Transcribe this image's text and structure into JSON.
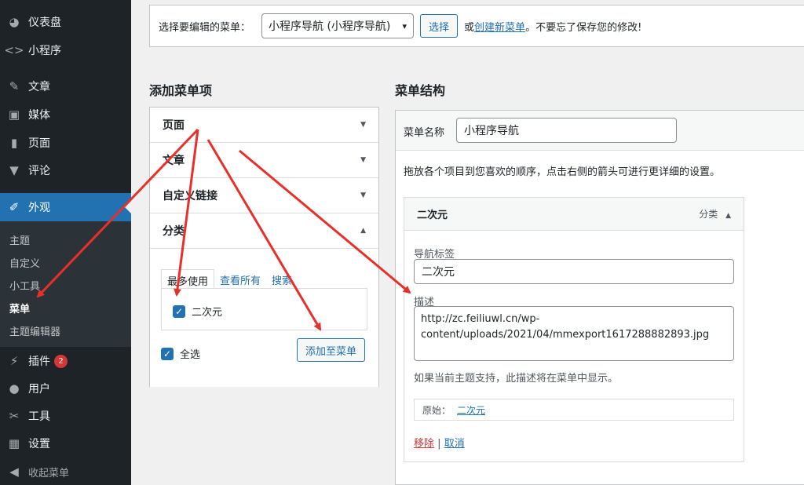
{
  "sidebar": {
    "dashboard": "仪表盘",
    "miniprogram": "小程序",
    "posts": "文章",
    "media": "媒体",
    "pages": "页面",
    "comments": "评论",
    "appearance": "外观",
    "submenu": [
      "主题",
      "自定义",
      "小工具",
      "菜单",
      "主题编辑器"
    ],
    "plugins": "插件",
    "plugins_badge": "2",
    "users": "用户",
    "tools": "工具",
    "settings": "设置",
    "collapse": "收起菜单"
  },
  "manage": {
    "label": "选择要编辑的菜单：",
    "selected_menu": "小程序导航 (小程序导航)",
    "select_button": "选择",
    "or_text": "或",
    "create_link": "创建新菜单",
    "save_hint": "。不要忘了保存您的修改!"
  },
  "add_items": {
    "title": "添加菜单项",
    "sections": [
      "页面",
      "文章",
      "自定义链接",
      "分类"
    ],
    "tabs": [
      "最多使用",
      "查看所有",
      "搜索"
    ],
    "category_item": "二次元",
    "select_all": "全选",
    "add_button": "添加至菜单"
  },
  "structure": {
    "title": "菜单结构",
    "name_label": "菜单名称",
    "name_value": "小程序导航",
    "instructions": "拖放各个项目到您喜欢的顺序，点击右侧的箭头可进行更详细的设置。",
    "item": {
      "title": "二次元",
      "type": "分类",
      "nav_label_label": "导航标签",
      "nav_label_value": "二次元",
      "desc_label": "描述",
      "desc_value": "http://zc.feiliuwl.cn/wp-content/uploads/2021/04/mmexport1617288882893.jpg",
      "desc_hint": "如果当前主题支持，此描述将在菜单中显示。",
      "original_label": "原始：",
      "original_link": "二次元",
      "remove": "移除",
      "separator": "|",
      "cancel": "取消"
    }
  },
  "colors": {
    "accent": "#2271b1",
    "annotation_arrow": "#e8302b",
    "sidebar_bg": "#1d2327"
  }
}
